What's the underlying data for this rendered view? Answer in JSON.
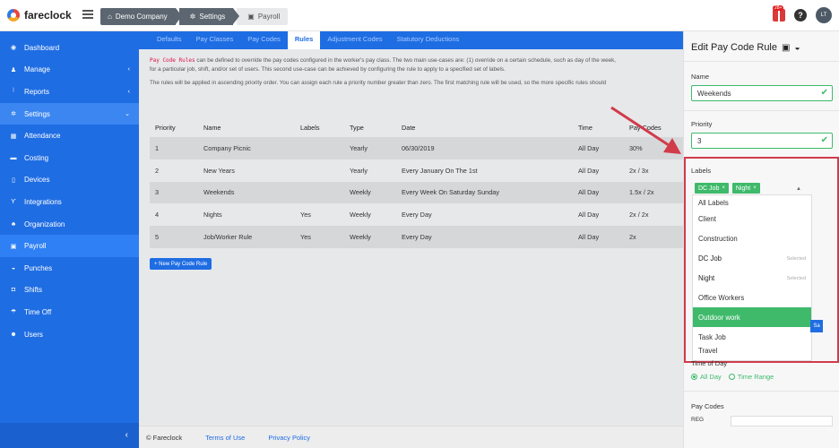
{
  "app": {
    "name": "fareclock"
  },
  "breadcrumb": [
    {
      "label": "Demo Company",
      "icon": "home-icon"
    },
    {
      "label": "Settings",
      "icon": "gear-icon"
    },
    {
      "label": "Payroll",
      "icon": "money-icon"
    }
  ],
  "topbar": {
    "notification_count": "28+",
    "help": "?",
    "avatar_initials": "LT"
  },
  "sidebar": {
    "items": [
      {
        "label": "Dashboard",
        "icon": "dashboard-icon"
      },
      {
        "label": "Manage",
        "icon": "user-icon",
        "chevron": "‹"
      },
      {
        "label": "Reports",
        "icon": "chart-icon",
        "chevron": "‹"
      },
      {
        "label": "Settings",
        "icon": "gear-icon",
        "chevron": "⌄"
      },
      {
        "label": "Attendance",
        "icon": "calendar-icon"
      },
      {
        "label": "Costing",
        "icon": "folder-icon"
      },
      {
        "label": "Devices",
        "icon": "tablet-icon"
      },
      {
        "label": "Integrations",
        "icon": "plug-icon"
      },
      {
        "label": "Organization",
        "icon": "sitemap-icon"
      },
      {
        "label": "Payroll",
        "icon": "money-icon"
      },
      {
        "label": "Punches",
        "icon": "car-icon"
      },
      {
        "label": "Shifts",
        "icon": "briefcase-icon"
      },
      {
        "label": "Time Off",
        "icon": "umbrella-icon"
      },
      {
        "label": "Users",
        "icon": "users-icon"
      }
    ],
    "collapse": "‹"
  },
  "tabs": [
    "Defaults",
    "Pay Classes",
    "Pay Codes",
    "Rules",
    "Adjustment Codes",
    "Statutory Deductions"
  ],
  "intro": {
    "code": "Pay Code Rules",
    "line1": " can be defined to override the pay codes configured in the worker's pay class. The two main use-cases are: (1) override on a certain schedule, such as day of the week,",
    "line2": "for a particular job, shift, and/or set of users. This second use-case can be achieved by configuring the rule to apply to a specified set of labels.",
    "line3": "The rules will be applied in ascending priority order. You can assign each rule a priority number greater than zero. The first matching rule will be used, so the more specific rules should"
  },
  "rules_table": {
    "headers": [
      "Priority",
      "Name",
      "Labels",
      "Type",
      "Date",
      "Time",
      "Pay Codes"
    ],
    "rows": [
      [
        "1",
        "Company Picnic",
        "",
        "Yearly",
        "06/30/2019",
        "All Day",
        "30%"
      ],
      [
        "2",
        "New Years",
        "",
        "Yearly",
        "Every January On The 1st",
        "All Day",
        "2x / 3x"
      ],
      [
        "3",
        "Weekends",
        "",
        "Weekly",
        "Every Week On Saturday Sunday",
        "All Day",
        "1.5x / 2x"
      ],
      [
        "4",
        "Nights",
        "Yes",
        "Weekly",
        "Every Day",
        "All Day",
        "2x / 2x"
      ],
      [
        "5",
        "Job/Worker Rule",
        "Yes",
        "Weekly",
        "Every Day",
        "All Day",
        "2x"
      ]
    ]
  },
  "new_rule_button": "+ New Pay Code Rule",
  "footer": {
    "copyright": "© Fareclock",
    "terms": "Terms of Use",
    "privacy": "Privacy Policy"
  },
  "panel": {
    "title": "Edit Pay Code Rule",
    "name_label": "Name",
    "name_value": "Weekends",
    "priority_label": "Priority",
    "priority_value": "3",
    "labels_label": "Labels",
    "selected_tags": [
      "DC Job",
      "Night"
    ],
    "options": [
      {
        "label": "All Labels",
        "note": ""
      },
      {
        "label": "Client",
        "note": ""
      },
      {
        "label": "Construction",
        "note": ""
      },
      {
        "label": "DC Job",
        "note": "Selected"
      },
      {
        "label": "Night",
        "note": "Selected"
      },
      {
        "label": "Office Workers",
        "note": ""
      },
      {
        "label": "Outdoor work",
        "note": ""
      },
      {
        "label": "Task Job",
        "note": ""
      },
      {
        "label": "Travel",
        "note": ""
      }
    ],
    "save_stub": "Sa",
    "time_of_day_label": "Time of Day",
    "time_all_day": "All Day",
    "time_range": "Time Range",
    "pay_codes_label": "Pay Codes",
    "pay_codes_stub": "REG"
  },
  "colors": {
    "primary": "#1f6de3",
    "success": "#3fba6b",
    "annotation": "#d13b4a"
  }
}
